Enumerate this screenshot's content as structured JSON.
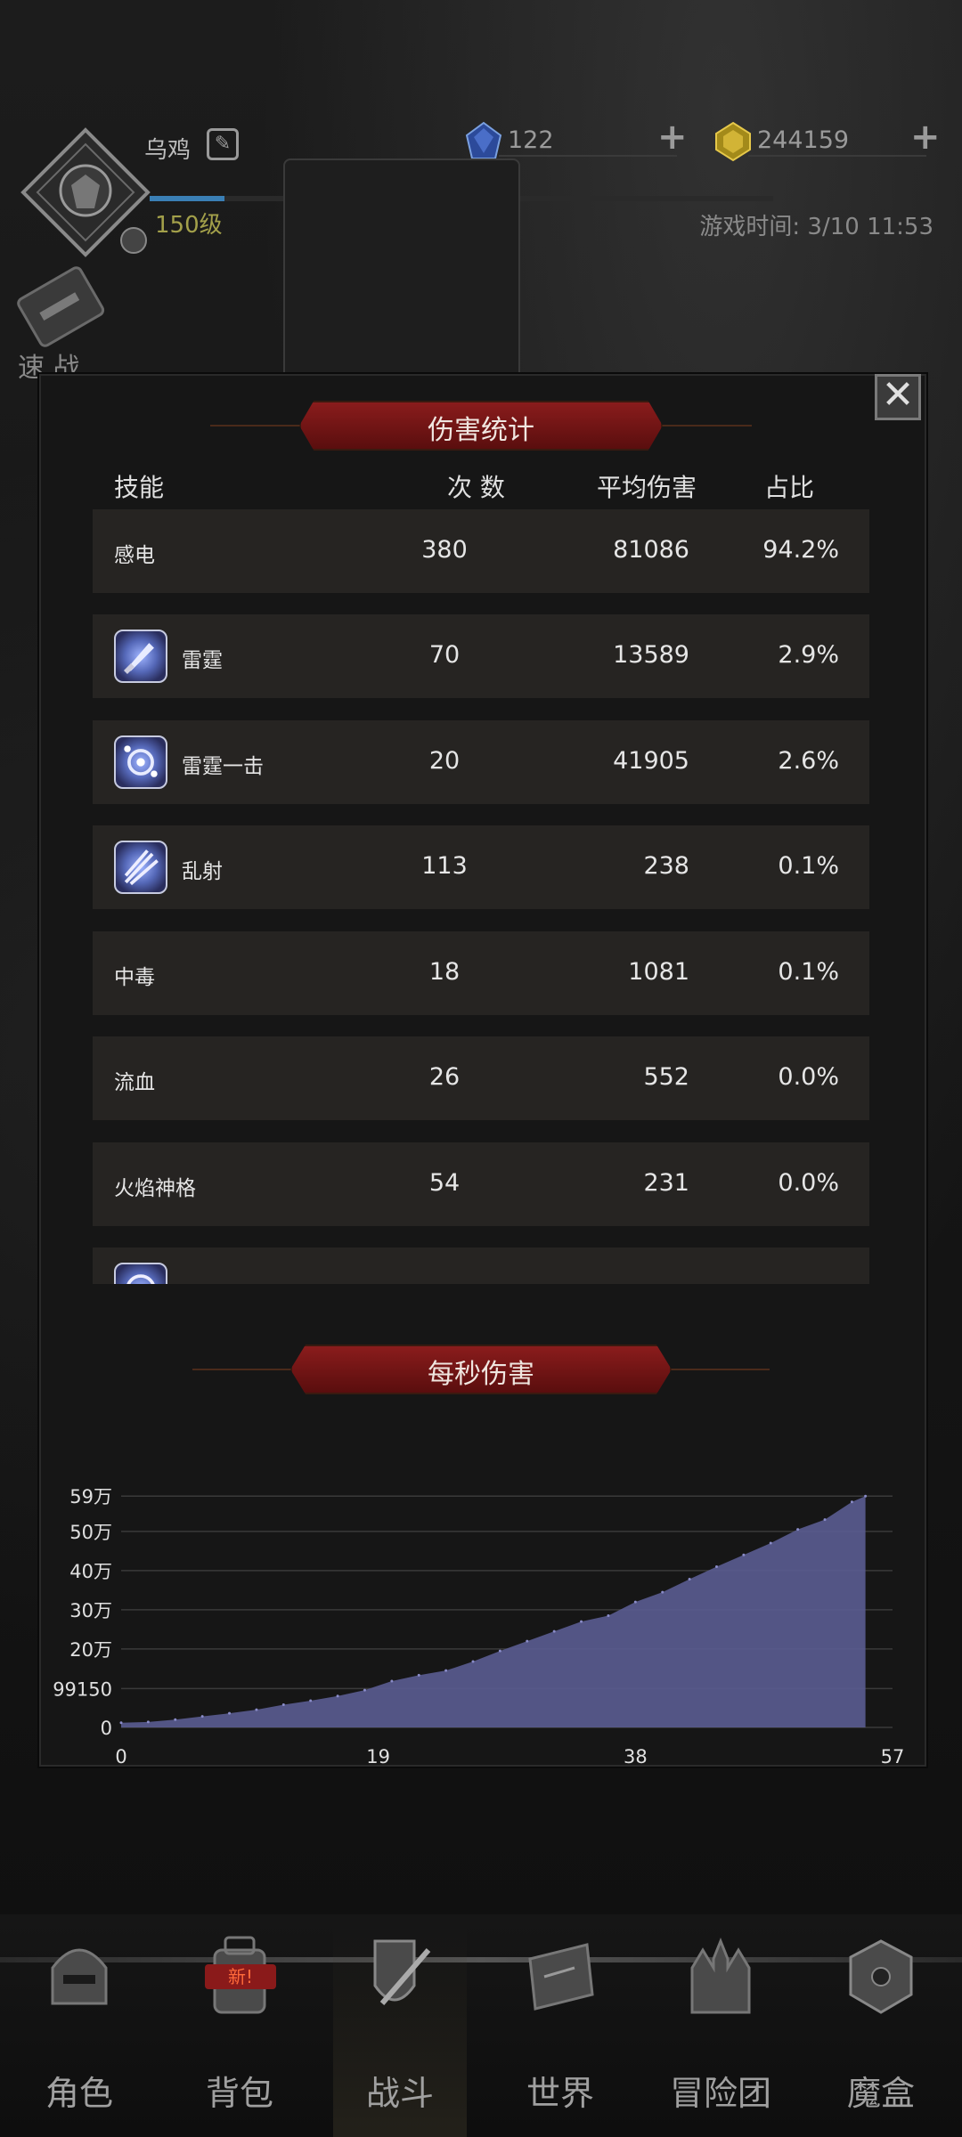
{
  "header": {
    "player_name": "乌鸡",
    "level": "150级",
    "gems": "122",
    "gold": "244159",
    "game_time": "游戏时间: 3/10 11:53",
    "quick_battle_label": "速 战"
  },
  "damage_stats": {
    "title": "伤害统计",
    "columns": {
      "skill": "技能",
      "count": "次 数",
      "avg": "平均伤害",
      "pct": "占比"
    },
    "rows": [
      {
        "name": "感电",
        "count": "380",
        "avg": "81086",
        "pct": "94.2%",
        "icon": ""
      },
      {
        "name": "雷霆",
        "count": "70",
        "avg": "13589",
        "pct": "2.9%",
        "icon": "thunder-sword-icon"
      },
      {
        "name": "雷霆一击",
        "count": "20",
        "avg": "41905",
        "pct": "2.6%",
        "icon": "thunder-strike-icon"
      },
      {
        "name": "乱射",
        "count": "113",
        "avg": "238",
        "pct": "0.1%",
        "icon": "scatter-shot-icon"
      },
      {
        "name": "中毒",
        "count": "18",
        "avg": "1081",
        "pct": "0.1%",
        "icon": ""
      },
      {
        "name": "流血",
        "count": "26",
        "avg": "552",
        "pct": "0.0%",
        "icon": ""
      },
      {
        "name": "火焰神格",
        "count": "54",
        "avg": "231",
        "pct": "0.0%",
        "icon": ""
      }
    ]
  },
  "dps": {
    "title": "每秒伤害"
  },
  "chart_data": {
    "type": "area",
    "title": "每秒伤害",
    "xlabel": "",
    "ylabel": "",
    "x_ticks": [
      "0",
      "19",
      "38",
      "57"
    ],
    "y_ticks": [
      "0",
      "99150",
      "20万",
      "30万",
      "40万",
      "50万",
      "59万"
    ],
    "y_tick_values": [
      0,
      99150,
      200000,
      300000,
      400000,
      500000,
      590000
    ],
    "xlim": [
      0,
      57
    ],
    "ylim": [
      0,
      595000
    ],
    "grid": true,
    "color": "#5a5c91",
    "x": [
      0,
      2,
      4,
      6,
      8,
      10,
      12,
      14,
      16,
      18,
      20,
      22,
      24,
      26,
      28,
      30,
      32,
      34,
      36,
      38,
      40,
      42,
      44,
      46,
      48,
      50,
      52,
      54,
      55
    ],
    "y": [
      12000,
      14000,
      20000,
      28000,
      36000,
      45000,
      58000,
      68000,
      80000,
      95000,
      118000,
      133000,
      145000,
      168000,
      195000,
      220000,
      245000,
      270000,
      285000,
      320000,
      345000,
      378000,
      410000,
      440000,
      470000,
      505000,
      530000,
      575000,
      590000
    ]
  },
  "nav": {
    "items": [
      {
        "label": "角色",
        "icon": "helmet-icon"
      },
      {
        "label": "背包",
        "icon": "backpack-icon"
      },
      {
        "label": "战斗",
        "icon": "sword-shield-icon"
      },
      {
        "label": "世界",
        "icon": "map-scroll-icon"
      },
      {
        "label": "冒险团",
        "icon": "castle-icon"
      },
      {
        "label": "魔盒",
        "icon": "magic-box-icon"
      }
    ],
    "new_badge": "新!"
  },
  "colors": {
    "banner_red": "#7a1616",
    "row_bg": "#262422",
    "area_fill": "#5a5c91",
    "level_text": "#a3a04a"
  }
}
